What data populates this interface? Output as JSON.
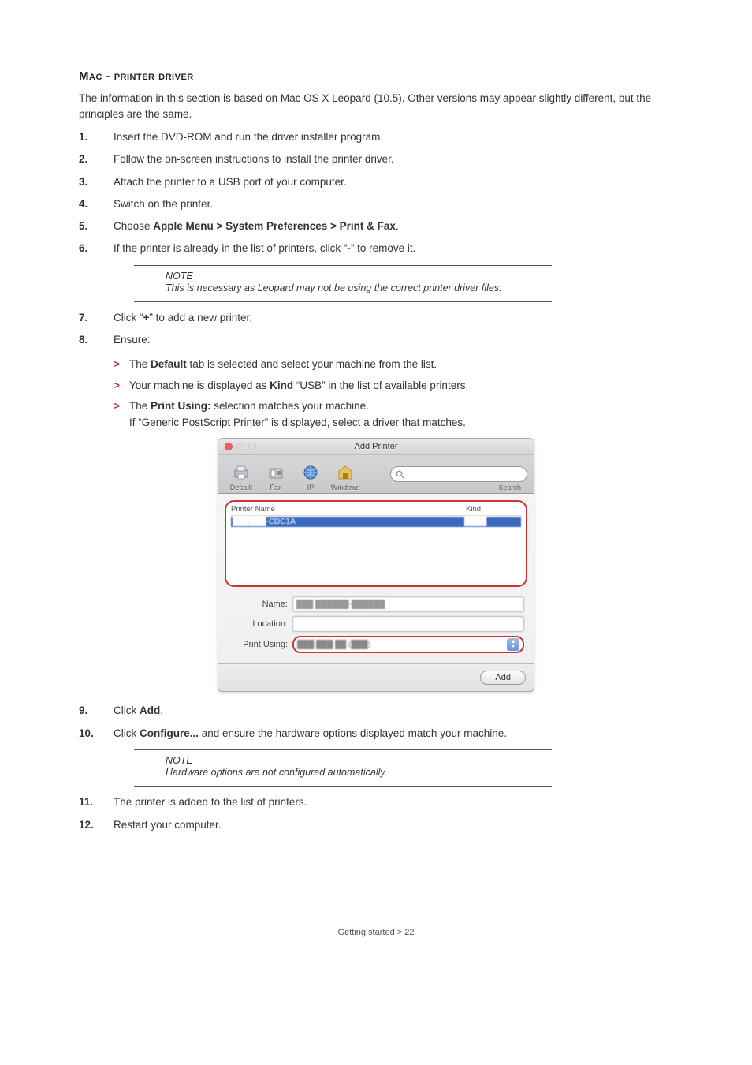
{
  "heading": "Mac - printer driver",
  "intro": "The information in this section is based on Mac OS X Leopard (10.5). Other versions may appear slightly different, but the principles are the same.",
  "steps": {
    "s1": {
      "num": "1.",
      "text": "Insert the DVD-ROM and run the driver installer program."
    },
    "s2": {
      "num": "2.",
      "text": "Follow the on-screen instructions to install the printer driver."
    },
    "s3": {
      "num": "3.",
      "text": "Attach the printer to a USB port of your computer."
    },
    "s4": {
      "num": "4.",
      "text": "Switch on the printer."
    },
    "s5": {
      "num": "5.",
      "pre": "Choose ",
      "bold": "Apple Menu > System Preferences > Print & Fax",
      "post": "."
    },
    "s6": {
      "num": "6.",
      "pre": "If the printer is already in the list of printers, click “",
      "bold": "-",
      "post": "” to remove it."
    },
    "s7": {
      "num": "7.",
      "pre": "Click “",
      "bold": "+",
      "post": "” to add a new printer."
    },
    "s8": {
      "num": "8.",
      "text": "Ensure:"
    },
    "s9": {
      "num": "9.",
      "pre": "Click ",
      "bold": "Add",
      "post": "."
    },
    "s10": {
      "num": "10.",
      "pre": "Click ",
      "bold": "Configure...",
      "post": " and ensure the hardware options displayed match your machine."
    },
    "s11": {
      "num": "11.",
      "text": "The printer is added to the list of printers."
    },
    "s12": {
      "num": "12.",
      "text": "Restart your computer."
    }
  },
  "sub8": {
    "a": {
      "pre": "The ",
      "bold": "Default",
      "post": " tab is selected and select your machine from the list."
    },
    "b": {
      "pre": "Your machine is displayed as ",
      "bold": "Kind",
      "post": " “USB” in the list of available printers."
    },
    "c": {
      "pre": "The ",
      "bold": "Print Using:",
      "post": " selection matches your machine.",
      "line2": "If “Generic PostScript Printer” is displayed, select a driver that matches."
    }
  },
  "note1": {
    "label": "NOTE",
    "text": "This is necessary as Leopard may not be using the correct printer driver files."
  },
  "note2": {
    "label": "NOTE",
    "text": "Hardware options are not configured automatically."
  },
  "dialog": {
    "title": "Add Printer",
    "tabs": {
      "default": "Default",
      "fax": "Fax",
      "ip": "IP",
      "windows": "Windows"
    },
    "search_label": "Search",
    "list_header_name": "Printer Name",
    "list_header_kind": "Kind",
    "form": {
      "name": "Name:",
      "location": "Location:",
      "print_using": "Print Using:"
    },
    "add_button": "Add"
  },
  "footer": "Getting started > 22"
}
